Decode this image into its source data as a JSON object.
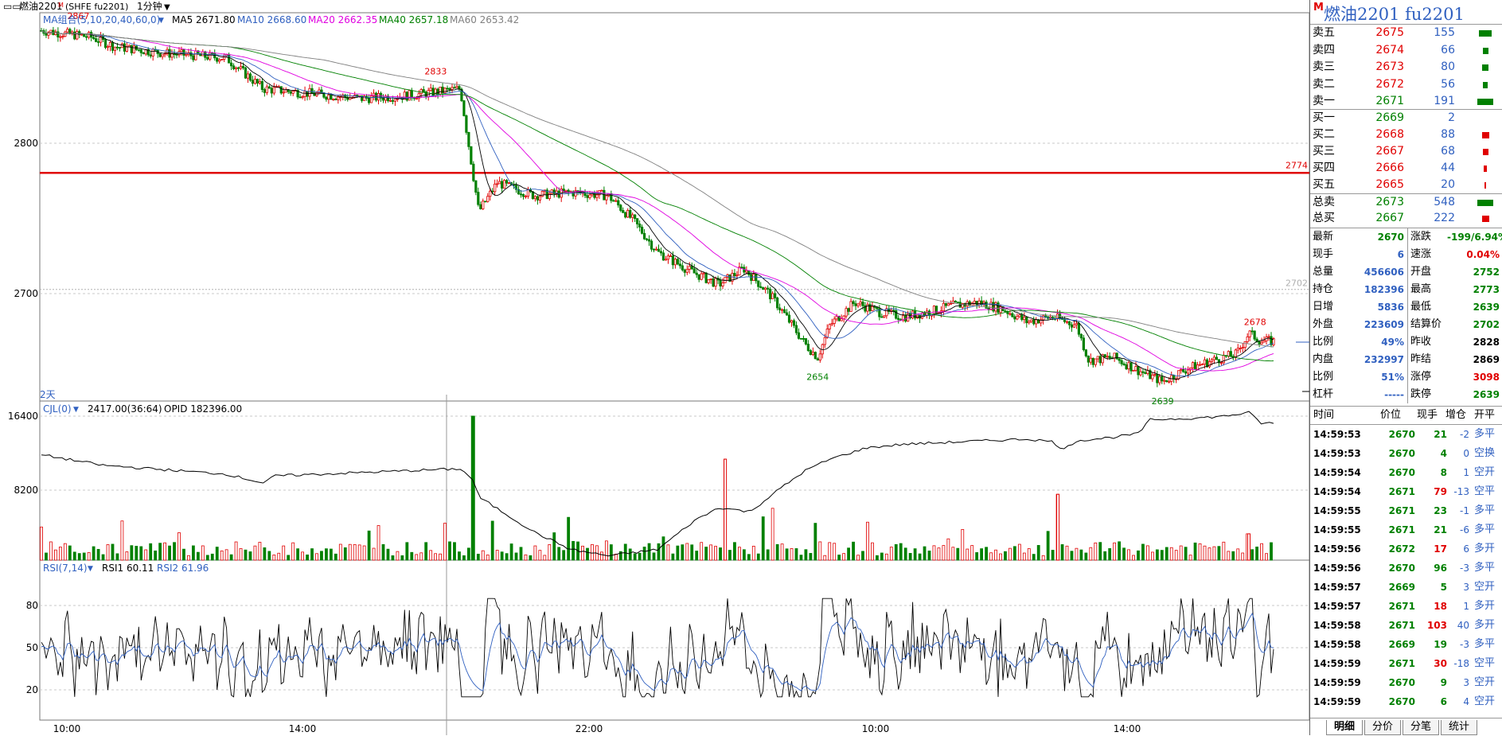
{
  "header": {
    "icon": "square-double-icon",
    "title": "燃油2201",
    "title_mark": "M",
    "code": "(SHFE fu2201)",
    "period": "1分钟"
  },
  "indicators": {
    "ma_group": "MA组合(5,10,20,40,60,0)",
    "ma5": "MA5 2671.80",
    "ma10": "MA10 2668.60",
    "ma20": "MA20 2662.35",
    "ma40": "MA40 2657.18",
    "ma60": "MA60 2653.42",
    "cjl_name": "CJL(0)",
    "cjl_val": "2417.00(36:64)",
    "opid": "OPID 182396.00",
    "rsi_name": "RSI(7,14)",
    "rsi1": "RSI1 60.11",
    "rsi2": "RSI2 61.96",
    "days_label": "2天"
  },
  "colors": {
    "ma5": "#000000",
    "ma10": "#3060c0",
    "ma20": "#e000e0",
    "ma40": "#008000",
    "ma60": "#808080",
    "up": "#e00000",
    "down": "#008000"
  },
  "chart_data": {
    "type": "candlestick",
    "price_axis": {
      "ticks": [
        "2800",
        "2700"
      ],
      "ylim": [
        2633,
        2873
      ]
    },
    "volume_axis": {
      "ticks": [
        "16400",
        "8200"
      ]
    },
    "rsi_axis": {
      "ticks": [
        "80",
        "50",
        "20"
      ]
    },
    "time_axis": [
      "10:00",
      "14:00",
      "22:00",
      "10:00",
      "14:00"
    ],
    "ref_line": "2774",
    "ref_line_value": 2774,
    "settle_label": "2702",
    "settle_value": 2702,
    "annotations": [
      {
        "text": "2867",
        "value": 2867,
        "color": "#e00000"
      },
      {
        "text": "2833",
        "value": 2833,
        "color": "#e00000"
      },
      {
        "text": "2654",
        "value": 2654,
        "color": "#008000"
      },
      {
        "text": "2639",
        "value": 2639,
        "color": "#008000"
      },
      {
        "text": "2678",
        "value": 2678,
        "color": "#e00000"
      }
    ],
    "price_path": [
      [
        0,
        2862
      ],
      [
        0.04,
        2858
      ],
      [
        0.06,
        2852
      ],
      [
        0.1,
        2848
      ],
      [
        0.15,
        2845
      ],
      [
        0.18,
        2826
      ],
      [
        0.22,
        2823
      ],
      [
        0.26,
        2820
      ],
      [
        0.3,
        2822
      ],
      [
        0.32,
        2824
      ],
      [
        0.34,
        2826
      ],
      [
        0.35,
        2775
      ],
      [
        0.355,
        2750
      ],
      [
        0.37,
        2768
      ],
      [
        0.4,
        2760
      ],
      [
        0.43,
        2762
      ],
      [
        0.46,
        2760
      ],
      [
        0.48,
        2745
      ],
      [
        0.5,
        2725
      ],
      [
        0.53,
        2712
      ],
      [
        0.55,
        2705
      ],
      [
        0.57,
        2715
      ],
      [
        0.59,
        2700
      ],
      [
        0.6,
        2690
      ],
      [
        0.62,
        2668
      ],
      [
        0.63,
        2660
      ],
      [
        0.64,
        2680
      ],
      [
        0.66,
        2694
      ],
      [
        0.68,
        2688
      ],
      [
        0.7,
        2685
      ],
      [
        0.72,
        2688
      ],
      [
        0.74,
        2692
      ],
      [
        0.76,
        2694
      ],
      [
        0.78,
        2690
      ],
      [
        0.8,
        2682
      ],
      [
        0.82,
        2685
      ],
      [
        0.84,
        2680
      ],
      [
        0.85,
        2658
      ],
      [
        0.87,
        2660
      ],
      [
        0.89,
        2652
      ],
      [
        0.91,
        2645
      ],
      [
        0.93,
        2653
      ],
      [
        0.95,
        2658
      ],
      [
        0.97,
        2662
      ],
      [
        0.98,
        2675
      ],
      [
        0.99,
        2670
      ]
    ],
    "volume_spikes": [
      [
        0.35,
        16400
      ],
      [
        0.555,
        11500
      ],
      [
        0.825,
        7500
      ],
      [
        0.98,
        3000
      ]
    ],
    "opid_path": [
      [
        0,
        12000
      ],
      [
        0.05,
        10800
      ],
      [
        0.15,
        9800
      ],
      [
        0.18,
        8800
      ],
      [
        0.19,
        9600
      ],
      [
        0.3,
        10200
      ],
      [
        0.34,
        10400
      ],
      [
        0.35,
        9200
      ],
      [
        0.355,
        7200
      ],
      [
        0.4,
        3200
      ],
      [
        0.43,
        1200
      ],
      [
        0.46,
        500
      ],
      [
        0.5,
        1200
      ],
      [
        0.53,
        4500
      ],
      [
        0.55,
        6000
      ],
      [
        0.575,
        5500
      ],
      [
        0.6,
        8200
      ],
      [
        0.62,
        10200
      ],
      [
        0.64,
        11500
      ],
      [
        0.67,
        12800
      ],
      [
        0.7,
        13200
      ],
      [
        0.75,
        13500
      ],
      [
        0.8,
        13800
      ],
      [
        0.82,
        13500
      ],
      [
        0.83,
        12600
      ],
      [
        0.84,
        13600
      ],
      [
        0.87,
        14000
      ],
      [
        0.89,
        14400
      ],
      [
        0.9,
        16000
      ],
      [
        0.94,
        16200
      ],
      [
        0.96,
        16400
      ],
      [
        0.98,
        16800
      ],
      [
        0.99,
        15600
      ]
    ]
  },
  "quote_panel": {
    "title": "燃油2201  fu2201",
    "title_mark": "M",
    "asks": [
      {
        "label": "卖五",
        "price": "2675",
        "vol": "155",
        "bar": 0.8
      },
      {
        "label": "卖四",
        "price": "2674",
        "vol": "66",
        "bar": 0.35
      },
      {
        "label": "卖三",
        "price": "2673",
        "vol": "80",
        "bar": 0.42
      },
      {
        "label": "卖二",
        "price": "2672",
        "vol": "56",
        "bar": 0.3
      },
      {
        "label": "卖一",
        "price": "2671",
        "vol": "191",
        "bar": 1.0
      }
    ],
    "bids": [
      {
        "label": "买一",
        "price": "2669",
        "vol": "2",
        "bar": 0.0
      },
      {
        "label": "买二",
        "price": "2668",
        "vol": "88",
        "bar": 0.45
      },
      {
        "label": "买三",
        "price": "2667",
        "vol": "68",
        "bar": 0.35
      },
      {
        "label": "买四",
        "price": "2666",
        "vol": "44",
        "bar": 0.22
      },
      {
        "label": "买五",
        "price": "2665",
        "vol": "20",
        "bar": 0.1
      }
    ],
    "total_sell": {
      "label": "总卖",
      "price": "2673",
      "vol": "548",
      "bar": 1.0
    },
    "total_buy": {
      "label": "总买",
      "price": "2667",
      "vol": "222",
      "bar": 0.45
    },
    "stats": [
      {
        "l1": "最新",
        "v1": "2670",
        "c1": "#008000",
        "l2": "涨跌",
        "v2": "-199/6.94%",
        "c2": "#008000"
      },
      {
        "l1": "现手",
        "v1": "6",
        "c1": "#3060c0",
        "l2": "速涨",
        "v2": "0.04%",
        "c2": "#e00000"
      },
      {
        "l1": "总量",
        "v1": "456606",
        "c1": "#3060c0",
        "l2": "开盘",
        "v2": "2752",
        "c2": "#008000"
      },
      {
        "l1": "持仓",
        "v1": "182396",
        "c1": "#3060c0",
        "l2": "最高",
        "v2": "2773",
        "c2": "#008000"
      },
      {
        "l1": "日增",
        "v1": "5836",
        "c1": "#3060c0",
        "l2": "最低",
        "v2": "2639",
        "c2": "#008000"
      },
      {
        "l1": "外盘",
        "v1": "223609",
        "c1": "#3060c0",
        "l2": "结算价",
        "v2": "2702",
        "c2": "#008000"
      },
      {
        "l1": "比例",
        "v1": "49%",
        "c1": "#3060c0",
        "l2": "昨收",
        "v2": "2828",
        "c2": "#000000"
      },
      {
        "l1": "内盘",
        "v1": "232997",
        "c1": "#3060c0",
        "l2": "昨结",
        "v2": "2869",
        "c2": "#000000"
      },
      {
        "l1": "比例",
        "v1": "51%",
        "c1": "#3060c0",
        "l2": "涨停",
        "v2": "3098",
        "c2": "#e00000"
      },
      {
        "l1": "杠杆",
        "v1": "-----",
        "c1": "#3060c0",
        "l2": "跌停",
        "v2": "2639",
        "c2": "#008000"
      }
    ],
    "trade_header": {
      "time": "时间",
      "price": "价位",
      "qty": "现手",
      "oi": "增仓",
      "type": "开平"
    },
    "trades": [
      {
        "time": "14:59:53",
        "price": "2670",
        "qty": "21",
        "qc": "#008000",
        "oi": "-2",
        "type": "多平"
      },
      {
        "time": "14:59:53",
        "price": "2670",
        "qty": "4",
        "qc": "#008000",
        "oi": "0",
        "type": "空换"
      },
      {
        "time": "14:59:54",
        "price": "2670",
        "qty": "8",
        "qc": "#008000",
        "oi": "1",
        "type": "空开"
      },
      {
        "time": "14:59:54",
        "price": "2671",
        "qty": "79",
        "qc": "#e00000",
        "oi": "-13",
        "type": "空平"
      },
      {
        "time": "14:59:55",
        "price": "2671",
        "qty": "23",
        "qc": "#008000",
        "oi": "-1",
        "type": "多平"
      },
      {
        "time": "14:59:55",
        "price": "2671",
        "qty": "21",
        "qc": "#008000",
        "oi": "-6",
        "type": "多平"
      },
      {
        "time": "14:59:56",
        "price": "2672",
        "qty": "17",
        "qc": "#e00000",
        "oi": "6",
        "type": "多开"
      },
      {
        "time": "14:59:56",
        "price": "2670",
        "qty": "96",
        "qc": "#008000",
        "oi": "-3",
        "type": "多平"
      },
      {
        "time": "14:59:57",
        "price": "2669",
        "qty": "5",
        "qc": "#008000",
        "oi": "3",
        "type": "空开"
      },
      {
        "time": "14:59:57",
        "price": "2671",
        "qty": "18",
        "qc": "#e00000",
        "oi": "1",
        "type": "多开"
      },
      {
        "time": "14:59:58",
        "price": "2671",
        "qty": "103",
        "qc": "#e00000",
        "oi": "40",
        "type": "多开"
      },
      {
        "time": "14:59:58",
        "price": "2669",
        "qty": "19",
        "qc": "#008000",
        "oi": "-3",
        "type": "多平"
      },
      {
        "time": "14:59:59",
        "price": "2671",
        "qty": "30",
        "qc": "#e00000",
        "oi": "-18",
        "type": "空平"
      },
      {
        "time": "14:59:59",
        "price": "2670",
        "qty": "9",
        "qc": "#008000",
        "oi": "3",
        "type": "空开"
      },
      {
        "time": "14:59:59",
        "price": "2670",
        "qty": "6",
        "qc": "#008000",
        "oi": "4",
        "type": "空开"
      }
    ],
    "tabs": [
      "明细",
      "分价",
      "分笔",
      "统计"
    ]
  }
}
